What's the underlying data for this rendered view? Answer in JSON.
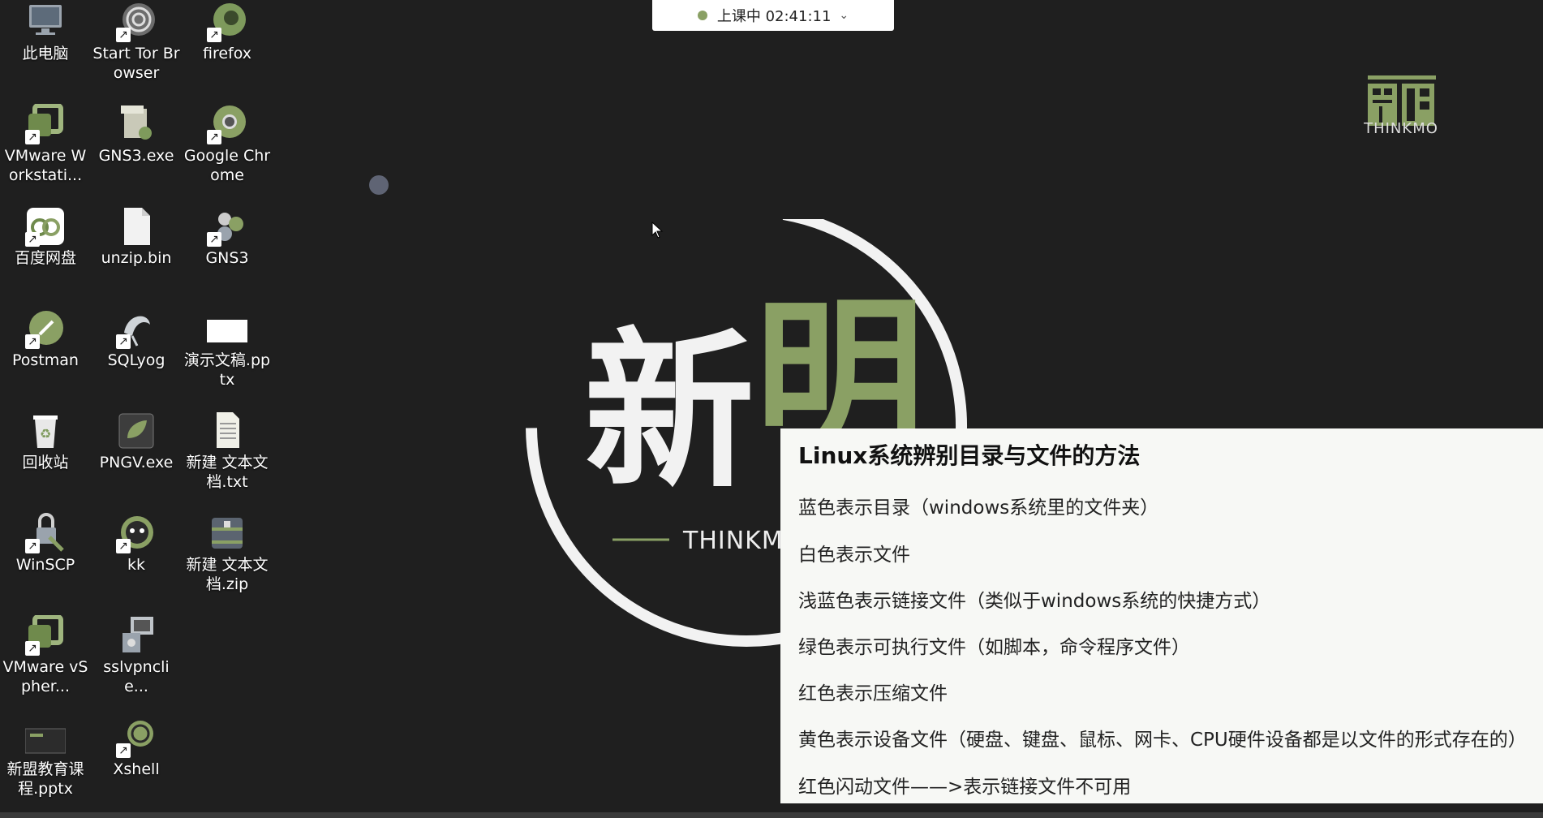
{
  "record_bar": {
    "status": "上课中 02:41:11"
  },
  "corner_logo": {
    "text": "THINKMO"
  },
  "center_logo": {
    "text": "THINKMO"
  },
  "desktop_icons": [
    {
      "label": "此电脑",
      "icon": "computer-icon"
    },
    {
      "label": "Start Tor Browser",
      "icon": "tor-icon"
    },
    {
      "label": "firefox",
      "icon": "firefox-icon"
    },
    {
      "label": "VMware Workstati...",
      "icon": "vmware-icon"
    },
    {
      "label": "GNS3.exe",
      "icon": "gns3-installer-icon"
    },
    {
      "label": "Google Chrome",
      "icon": "chrome-icon"
    },
    {
      "label": "百度网盘",
      "icon": "baidu-netdisk-icon"
    },
    {
      "label": "unzip.bin",
      "icon": "file-icon"
    },
    {
      "label": "GNS3",
      "icon": "gns3-icon"
    },
    {
      "label": "Postman",
      "icon": "postman-icon"
    },
    {
      "label": "SQLyog",
      "icon": "sqlyog-icon"
    },
    {
      "label": "演示文稿.pptx",
      "icon": "pptx-icon"
    },
    {
      "label": "回收站",
      "icon": "recycle-bin-icon"
    },
    {
      "label": "PNGV.exe",
      "icon": "pngv-icon"
    },
    {
      "label": "新建 文本文档.txt",
      "icon": "text-file-icon"
    },
    {
      "label": "WinSCP",
      "icon": "winscp-icon"
    },
    {
      "label": "kk",
      "icon": "kk-icon"
    },
    {
      "label": "新建 文本文档.zip",
      "icon": "zip-icon"
    },
    {
      "label": "VMware vSpher...",
      "icon": "vsphere-icon"
    },
    {
      "label": "sslvpnclie...",
      "icon": "sslvpn-icon"
    },
    {
      "label": "",
      "icon": ""
    },
    {
      "label": "新盟教育课程.pptx",
      "icon": "pptx-thumb-icon"
    },
    {
      "label": "Xshell",
      "icon": "xshell-icon"
    }
  ],
  "info_card": {
    "title": "Linux系统辨别目录与文件的方法",
    "lines": [
      "蓝色表示目录（windows系统里的文件夹）",
      "白色表示文件",
      "浅蓝色表示链接文件（类似于windows系统的快捷方式）",
      "绿色表示可执行文件（如脚本，命令程序文件）",
      "红色表示压缩文件",
      "黄色表示设备文件（硬盘、键盘、鼠标、网卡、CPU硬件设备都是以文件的形式存在的）",
      "红色闪动文件——>表示链接文件不可用"
    ]
  },
  "colors": {
    "accent": "#8aa064",
    "background": "#1f1f1f"
  }
}
